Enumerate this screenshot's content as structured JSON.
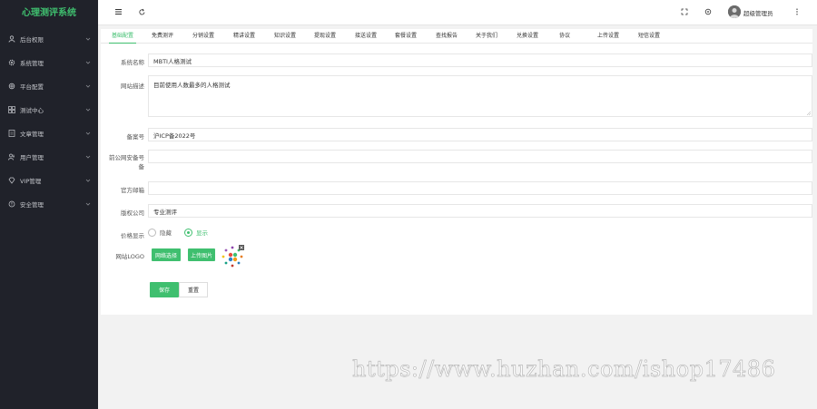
{
  "brand": {
    "title": "心理测评系统",
    "color": "#3fbf6f"
  },
  "sidebar": {
    "items": [
      {
        "label": "后台权限",
        "icon": "user-icon"
      },
      {
        "label": "系统管理",
        "icon": "gear-icon"
      },
      {
        "label": "平台配置",
        "icon": "settings-icon"
      },
      {
        "label": "测试中心",
        "icon": "grid-icon"
      },
      {
        "label": "文章管理",
        "icon": "document-icon"
      },
      {
        "label": "用户管理",
        "icon": "users-icon"
      },
      {
        "label": "VIP管理",
        "icon": "diamond-icon"
      },
      {
        "label": "安全管理",
        "icon": "shield-icon"
      }
    ]
  },
  "header": {
    "menu_icon": "hamburger-icon",
    "refresh_icon": "refresh-icon",
    "fullscreen_icon": "fullscreen-icon",
    "theme_icon": "theme-icon",
    "more_icon": "more-vertical-icon",
    "user_name": "超级管理员"
  },
  "tabs": [
    "基础配置",
    "免费测评",
    "分销设置",
    "精讲设置",
    "知识设置",
    "提现设置",
    "接送设置",
    "套餐设置",
    "查找报告",
    "关于我们",
    "兑换设置",
    "协议",
    "上传设置",
    "短信设置"
  ],
  "form": {
    "system_name": {
      "label": "系统名称",
      "value": "MBTI人格测试"
    },
    "site_desc": {
      "label": "网站描述",
      "value": "目前使用人数最多的人格测试"
    },
    "icp": {
      "label": "备案号",
      "value": "沪ICP备2022号"
    },
    "police": {
      "label": "前公网安备号",
      "label2": "备",
      "value": ""
    },
    "email": {
      "label": "官方邮箱",
      "value": ""
    },
    "company": {
      "label": "版权公司",
      "value": "专业测评"
    },
    "price_show": {
      "label": "价格显示",
      "options": [
        "隐藏",
        "显示"
      ],
      "selected": "显示"
    },
    "logo": {
      "label": "网站LOGO",
      "choose_button": "网络选择",
      "upload_button": "上传图片"
    }
  },
  "actions": {
    "save": "保存",
    "reset": "重置"
  },
  "watermark": "https://www.huzhan.com/ishop17486"
}
